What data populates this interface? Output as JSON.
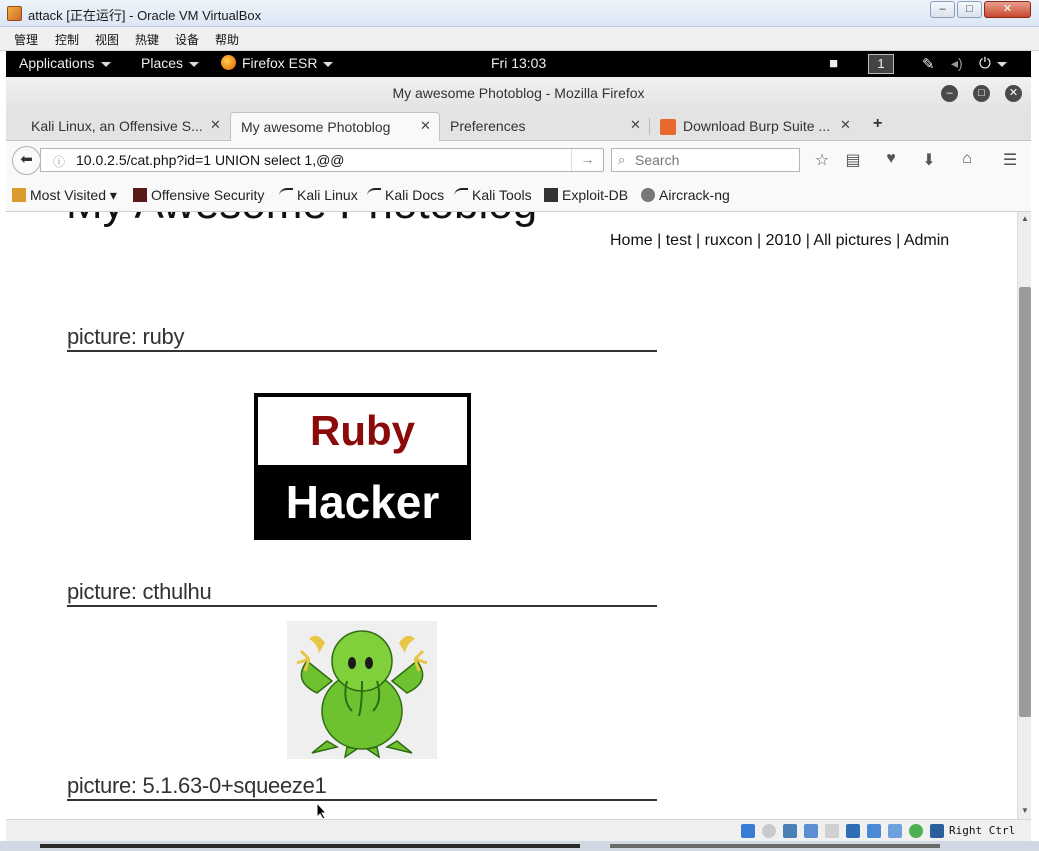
{
  "vbox": {
    "title": "attack [正在运行] - Oracle VM VirtualBox",
    "menu": [
      "管理",
      "控制",
      "视图",
      "热键",
      "设备",
      "帮助"
    ],
    "win_buttons": {
      "minimize": "‒",
      "maximize": "□",
      "close": "✕"
    },
    "status_key": "Right Ctrl"
  },
  "gnome": {
    "applications": "Applications",
    "places": "Places",
    "firefox": "Firefox ESR",
    "clock": "Fri 13:03",
    "workspace": "1"
  },
  "firefox": {
    "window_title": "My awesome Photoblog - Mozilla Firefox",
    "tabs": [
      {
        "label": "Kali Linux, an Offensive S...",
        "close": "✕"
      },
      {
        "label": "My awesome Photoblog",
        "close": "✕"
      },
      {
        "label": "Preferences",
        "close": "✕"
      },
      {
        "label": "Download Burp Suite ...",
        "close": "✕"
      }
    ],
    "new_tab": "+",
    "url": "10.0.2.5/cat.php?id=1 UNION select 1,@@",
    "search_placeholder": "Search",
    "bookmarks": [
      "Most Visited",
      "Offensive Security",
      "Kali Linux",
      "Kali Docs",
      "Kali Tools",
      "Exploit-DB",
      "Aircrack-ng"
    ]
  },
  "page": {
    "site_title": "My Awesome Photoblog",
    "nav": [
      {
        "label": "Home"
      },
      {
        "label": "test"
      },
      {
        "label": "ruxcon"
      },
      {
        "label": "2010"
      },
      {
        "label": "All pictures"
      },
      {
        "label": "Admin"
      }
    ],
    "pictures": [
      {
        "heading": "picture: ruby",
        "image_text_top": "Ruby",
        "image_text_bottom": "Hacker"
      },
      {
        "heading": "picture: cthulhu"
      },
      {
        "heading": "picture: 5.1.63-0+squeeze1"
      }
    ]
  },
  "colors": {
    "gnome_bar": "#000000",
    "ruby_red": "#8b0a0a",
    "cthulhu_green": "#6fc22f"
  }
}
